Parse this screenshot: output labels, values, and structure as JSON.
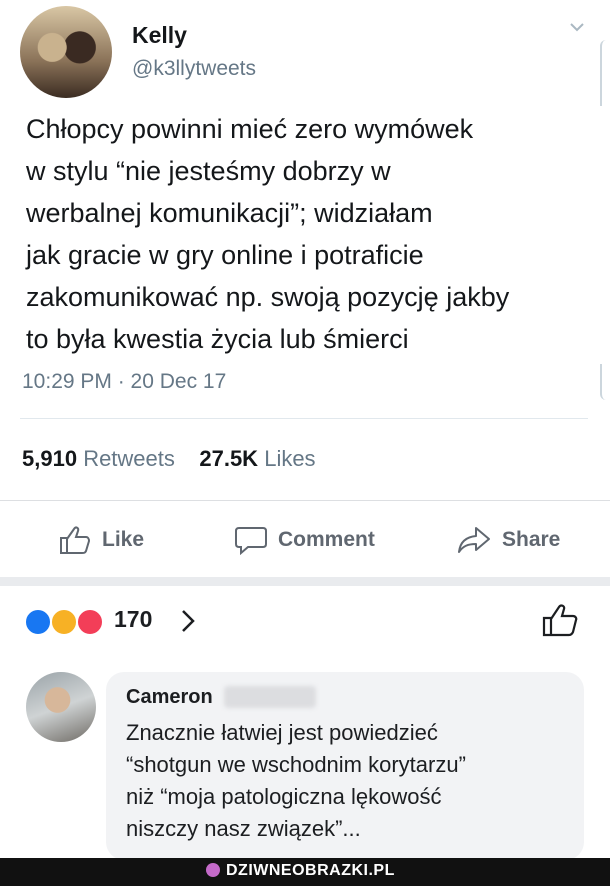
{
  "tweet": {
    "name": "Kelly",
    "handle": "@k3llytweets",
    "text_lines": [
      "Chłopcy powinni mieć zero wymówek",
      "w stylu “nie jesteśmy dobrzy w",
      "werbalnej komunikacji”; widziałam",
      "jak gracie w gry online i potraficie",
      "zakomunikować np. swoją pozycję jakby",
      "to była kwestia życia lub śmierci"
    ],
    "timestamp": "10:29 PM · 20 Dec 17",
    "retweets_count": "5,910",
    "retweets_label": "Retweets",
    "likes_count": "27.5K",
    "likes_label": "Likes"
  },
  "actions": {
    "like": "Like",
    "comment": "Comment",
    "share": "Share"
  },
  "reactions": {
    "count": "170",
    "icons": [
      "like-icon",
      "haha-icon",
      "love-icon"
    ],
    "colors": {
      "like": "#1877f2",
      "haha": "#f7b125",
      "love": "#f33e58"
    }
  },
  "comment": {
    "author": "Cameron",
    "lines": [
      "Znacznie łatwiej jest powiedzieć",
      "“shotgun we wschodnim korytarzu”",
      "niż “moja patologiczna lękowość",
      "niszczy nasz związek”..."
    ]
  },
  "watermark": "DZIWNEOBRAZKI.PL"
}
